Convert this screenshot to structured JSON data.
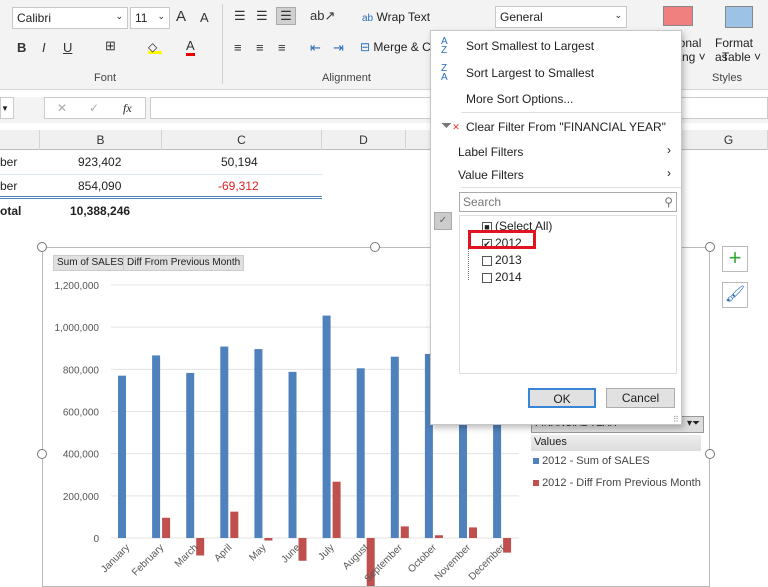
{
  "ribbon": {
    "font_name": "Calibri",
    "font_size": "11",
    "grow": "A",
    "shrink": "A",
    "bold": "B",
    "italic": "I",
    "underline": "U",
    "font_color": "A",
    "wrap_text": "Wrap Text",
    "merge": "Merge & C",
    "number_format": "General",
    "conditional": "ional",
    "conditional2": "ting ˅",
    "format_table": "Format as",
    "format_table2": "Table ˅",
    "groups": {
      "font": "Font",
      "alignment": "Alignment",
      "styles": "Styles"
    }
  },
  "formula": {
    "fx": "fx",
    "cancel": "✕",
    "enter": "✓"
  },
  "columns": [
    "B",
    "C",
    "D",
    "G"
  ],
  "rows": [
    {
      "a": "ber",
      "b": "923,402",
      "c": "50,194",
      "neg": false
    },
    {
      "a": "ber",
      "b": "854,090",
      "c": "-69,312",
      "neg": true
    },
    {
      "a": "otal",
      "b": "10,388,246",
      "c": ""
    }
  ],
  "chart": {
    "field_buttons": [
      "Sum of SALES",
      "Diff From Previous Month"
    ],
    "filter_field": "FINANCIAL YEAR",
    "values_label": "Values",
    "colors": {
      "sales": "#4f81bd",
      "diff": "#c0504d"
    }
  },
  "chart_data": {
    "type": "bar",
    "categories": [
      "January",
      "February",
      "March",
      "April",
      "May",
      "June",
      "July",
      "August",
      "September",
      "October",
      "November",
      "December"
    ],
    "series": [
      {
        "name": "2012 - Sum of SALES",
        "values": [
          770000,
          866000,
          783000,
          908000,
          896000,
          788000,
          1055000,
          805000,
          860000,
          873000,
          923402,
          854090
        ]
      },
      {
        "name": "2012 - Diff From Previous Month",
        "values": [
          0,
          96000,
          -83000,
          125000,
          -12000,
          -108000,
          267000,
          -250000,
          55000,
          13000,
          50194,
          -69312
        ]
      }
    ],
    "yticks": [
      "1,200,000",
      "1,000,000",
      "800,000",
      "600,000",
      "400,000",
      "200,000",
      "0"
    ],
    "ylim": [
      -400000,
      1200000
    ],
    "legend": "right"
  },
  "menu": {
    "sort_asc": "Sort Smallest to Largest",
    "sort_desc": "Sort Largest to Smallest",
    "more_sort": "More Sort Options...",
    "clear_filter": "Clear Filter From \"FINANCIAL YEAR\"",
    "label_filters": "Label Filters",
    "value_filters": "Value Filters",
    "search_placeholder": "Search",
    "items": [
      {
        "label": "(Select All)",
        "state": "mixed"
      },
      {
        "label": "2012",
        "state": "checked"
      },
      {
        "label": "2013",
        "state": "unchecked"
      },
      {
        "label": "2014",
        "state": "unchecked"
      }
    ],
    "ok": "OK",
    "cancel": "Cancel"
  }
}
